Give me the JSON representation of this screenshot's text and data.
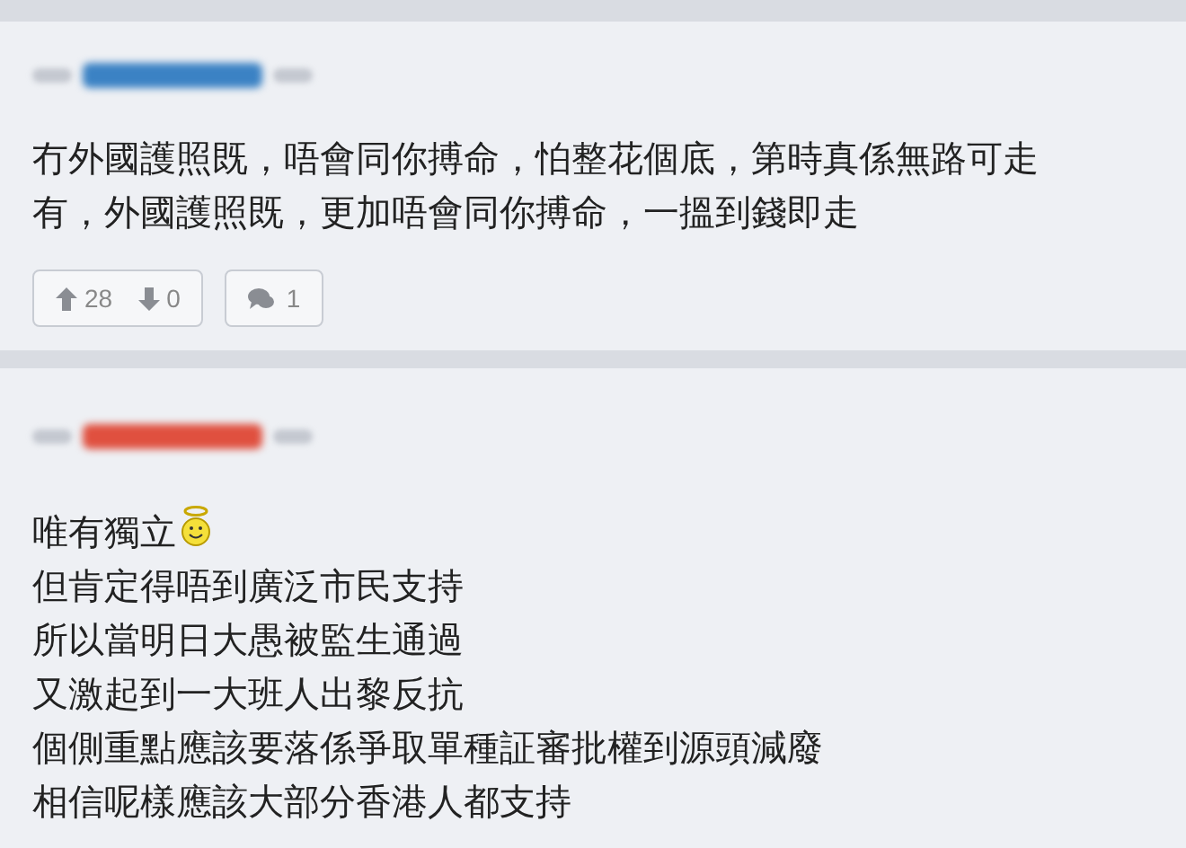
{
  "posts": [
    {
      "color": "#3b82c4",
      "lines": [
        {
          "kind": "plain",
          "text": "冇外國護照既，唔會同你搏命，怕整花個底，第時真係無路可走"
        },
        {
          "kind": "plain",
          "text": "有，外國護照既，更加唔會同你搏命，一搵到錢即走"
        }
      ],
      "upvotes": "28",
      "downvotes": "0",
      "replies": "1"
    },
    {
      "color": "#e0503f",
      "lines": [
        {
          "kind": "emoji",
          "text": "唯有獨立"
        },
        {
          "kind": "plain",
          "text": "但肯定得唔到廣泛市民支持"
        },
        {
          "kind": "plain",
          "text": "所以當明日大愚被監生通過"
        },
        {
          "kind": "plain",
          "text": "又激起到一大班人出黎反抗"
        },
        {
          "kind": "plain",
          "text": "個側重點應該要落係爭取單種証審批權到源頭減廢"
        },
        {
          "kind": "plain",
          "text": "相信呢樣應該大部分香港人都支持"
        }
      ]
    }
  ]
}
